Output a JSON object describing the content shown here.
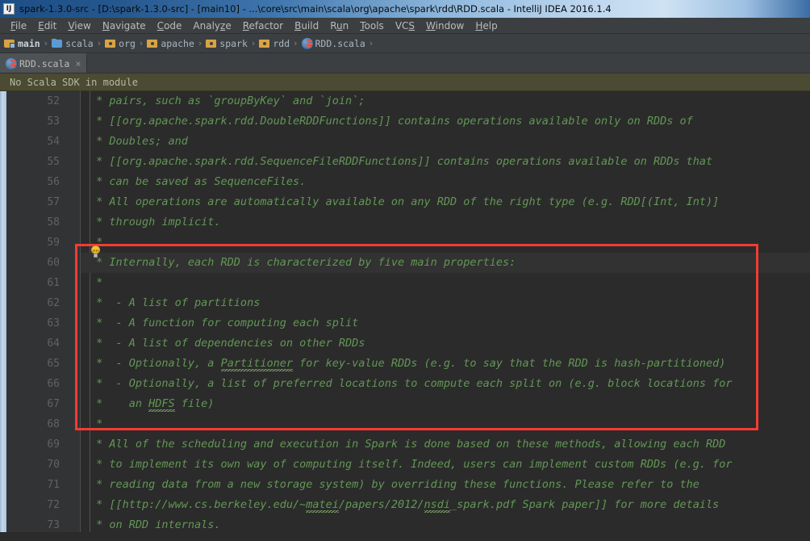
{
  "window": {
    "app_icon": "intellij-idea-icon",
    "title": "spark-1.3.0-src - [D:\\spark-1.3.0-src] - [main10] - ...\\core\\src\\main\\scala\\org\\apache\\spark\\rdd\\RDD.scala - IntelliJ IDEA 2016.1.4"
  },
  "menubar": {
    "items": [
      {
        "label": "File",
        "mnemonic": "F",
        "rest": "ile"
      },
      {
        "label": "Edit",
        "mnemonic": "E",
        "rest": "dit"
      },
      {
        "label": "View",
        "mnemonic": "V",
        "rest": "iew"
      },
      {
        "label": "Navigate",
        "mnemonic": "N",
        "rest": "avigate"
      },
      {
        "label": "Code",
        "mnemonic": "C",
        "rest": "ode"
      },
      {
        "label": "Analyze",
        "mnemonic": "z",
        "rest": "Analy|e",
        "pre": "Analy",
        "post": "e"
      },
      {
        "label": "Refactor",
        "mnemonic": "R",
        "rest": "efactor"
      },
      {
        "label": "Build",
        "mnemonic": "B",
        "rest": "uild"
      },
      {
        "label": "Run",
        "mnemonic": "u",
        "pre": "R",
        "post": "n"
      },
      {
        "label": "Tools",
        "mnemonic": "T",
        "rest": "ools"
      },
      {
        "label": "VCS",
        "mnemonic": "S",
        "pre": "VC",
        "post": ""
      },
      {
        "label": "Window",
        "mnemonic": "W",
        "rest": "indow"
      },
      {
        "label": "Help",
        "mnemonic": "H",
        "rest": "elp"
      }
    ]
  },
  "breadcrumb": {
    "separator": "›",
    "items": [
      {
        "label": "main",
        "icon": "source-root-folder-icon",
        "bold": true
      },
      {
        "label": "scala",
        "icon": "folder-blue-icon",
        "bold": false
      },
      {
        "label": "org",
        "icon": "package-icon",
        "bold": false
      },
      {
        "label": "apache",
        "icon": "package-icon",
        "bold": false
      },
      {
        "label": "spark",
        "icon": "package-icon",
        "bold": false
      },
      {
        "label": "rdd",
        "icon": "package-icon",
        "bold": false
      },
      {
        "label": "RDD.scala",
        "icon": "scala-file-icon",
        "bold": false
      }
    ]
  },
  "tabs": {
    "active": {
      "label": "RDD.scala",
      "icon": "scala-file-icon",
      "close": "×"
    }
  },
  "banner": {
    "message": "No Scala SDK in module"
  },
  "editor": {
    "first_line_number": 52,
    "current_line_number": 60,
    "bulb_icon": "intention-lightbulb-icon",
    "lines": [
      {
        "n": 52,
        "text": " * pairs, such as `groupByKey` and `join`;"
      },
      {
        "n": 53,
        "text": " * [[org.apache.spark.rdd.DoubleRDDFunctions]] contains operations available only on RDDs of"
      },
      {
        "n": 54,
        "text": " * Doubles; and"
      },
      {
        "n": 55,
        "text": " * [[org.apache.spark.rdd.SequenceFileRDDFunctions]] contains operations available on RDDs that"
      },
      {
        "n": 56,
        "text": " * can be saved as SequenceFiles."
      },
      {
        "n": 57,
        "text": " * All operations are automatically available on any RDD of the right type (e.g. RDD[(Int, Int)]"
      },
      {
        "n": 58,
        "text": " * through implicit."
      },
      {
        "n": 59,
        "text": " *"
      },
      {
        "n": 60,
        "text": " * Internally, each RDD is characterized by five main properties:"
      },
      {
        "n": 61,
        "text": " *"
      },
      {
        "n": 62,
        "text": " *  - A list of partitions"
      },
      {
        "n": 63,
        "text": " *  - A function for computing each split"
      },
      {
        "n": 64,
        "text": " *  - A list of dependencies on other RDDs"
      },
      {
        "n": 65,
        "text": " *  - Optionally, a Partitioner for key-value RDDs (e.g. to say that the RDD is hash-partitioned)"
      },
      {
        "n": 66,
        "text": " *  - Optionally, a list of preferred locations to compute each split on (e.g. block locations for"
      },
      {
        "n": 67,
        "text": " *    an HDFS file)"
      },
      {
        "n": 68,
        "text": " *"
      },
      {
        "n": 69,
        "text": " * All of the scheduling and execution in Spark is done based on these methods, allowing each RDD"
      },
      {
        "n": 70,
        "text": " * to implement its own way of computing itself. Indeed, users can implement custom RDDs (e.g. for"
      },
      {
        "n": 71,
        "text": " * reading data from a new storage system) by overriding these functions. Please refer to the"
      },
      {
        "n": 72,
        "text": " * [[http://www.cs.berkeley.edu/~matei/papers/2012/nsdi_spark.pdf Spark paper]] for more details"
      },
      {
        "n": 73,
        "text": " * on RDD internals."
      }
    ],
    "annotation": {
      "shape": "rectangle",
      "color": "#f33b33",
      "covers_lines": "60-68"
    }
  },
  "colors": {
    "editor_background": "#2b2b2b",
    "gutter_background": "#313335",
    "comment_text": "#629755",
    "chrome": "#3c3f41",
    "banner_background": "#4b4b33",
    "annotation_red": "#f33b33",
    "title_blue": "#25578e"
  }
}
